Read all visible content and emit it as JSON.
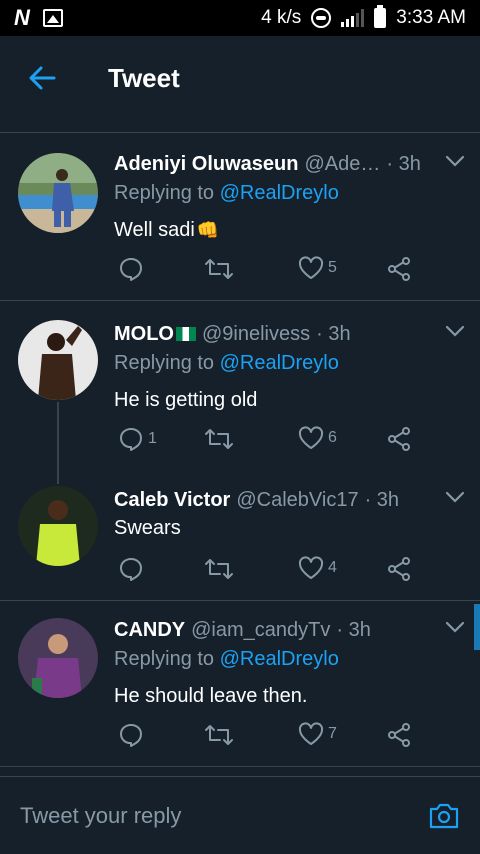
{
  "status_bar": {
    "net_speed": "4 k/s",
    "network_type": "H+",
    "time": "3:33 AM",
    "icons": [
      "n-app-icon",
      "image-icon",
      "data-saver-icon",
      "signal-icon",
      "battery-icon"
    ]
  },
  "header": {
    "title": "Tweet",
    "back_icon": "back-arrow-icon"
  },
  "colors": {
    "background": "#15202b",
    "accent": "#1da1f2",
    "secondary_text": "#8899a6",
    "divider": "#38444d"
  },
  "tweets": [
    {
      "name": "Adeniyi Oluwaseun",
      "handle": "@Ade…",
      "time": "· 3h",
      "replying_prefix": "Replying to",
      "replying_to": "@RealDreylo",
      "text": "Well sadi",
      "emoji": "👊",
      "replies": "",
      "likes": "5"
    },
    {
      "name": "MOLO",
      "flag": "nigeria-flag",
      "handle": "@9inelivess",
      "time": "· 3h",
      "replying_prefix": "Replying to",
      "replying_to": "@RealDreylo",
      "text": "He is getting old",
      "replies": "1",
      "likes": "6"
    },
    {
      "name": "Caleb Victor",
      "handle": "@CalebVic17",
      "time": "· 3h",
      "text": "Swears",
      "replies": "",
      "likes": "4"
    },
    {
      "name": "CANDY",
      "handle": "@iam_candyTv",
      "time": "· 3h",
      "replying_prefix": "Replying to",
      "replying_to": "@RealDreylo",
      "text": "He should leave then.",
      "replies": "",
      "likes": "7"
    }
  ],
  "composer": {
    "placeholder": "Tweet your reply",
    "camera_icon": "camera-icon"
  }
}
